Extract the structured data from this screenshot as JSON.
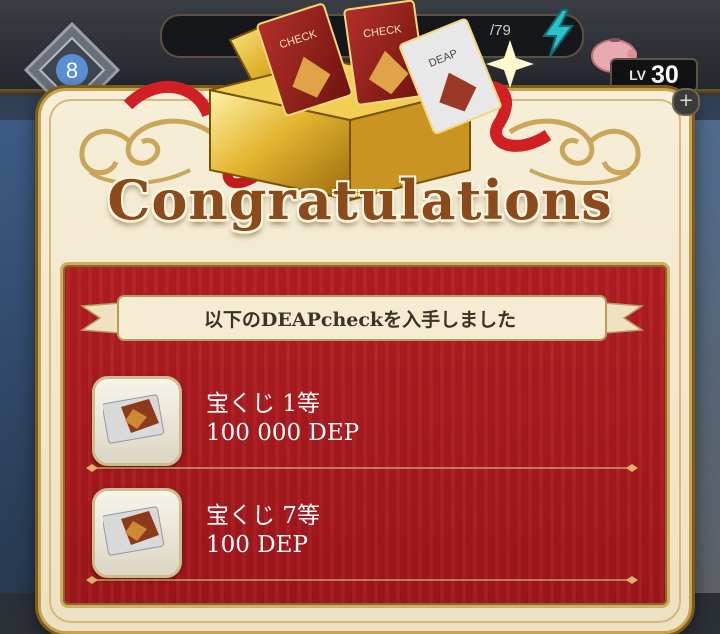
{
  "hud": {
    "count_text": "/79",
    "level_label": "LV",
    "level_value": "30",
    "plus_symbol": "+",
    "emblem_digit": "8",
    "icons": [
      "lightning-icon",
      "piggy-bank-icon",
      "plus-icon",
      "rank-emblem-icon"
    ]
  },
  "dialog": {
    "title": "Congratulations",
    "banner_text": "以下のDEAPcheckを入手しました",
    "items": [
      {
        "name": "宝くじ 1等",
        "amount": "100 000 DEP"
      },
      {
        "name": "宝くじ 7等",
        "amount": "100 DEP"
      }
    ],
    "gift_card_labels": [
      "CHECK",
      "CHECK",
      "DEAP"
    ]
  },
  "colors": {
    "panel_red": "#a81a1f",
    "gold": "#c9a24c",
    "title_brown": "#8a4a1c",
    "dialog_cream": "#f3ead2"
  }
}
